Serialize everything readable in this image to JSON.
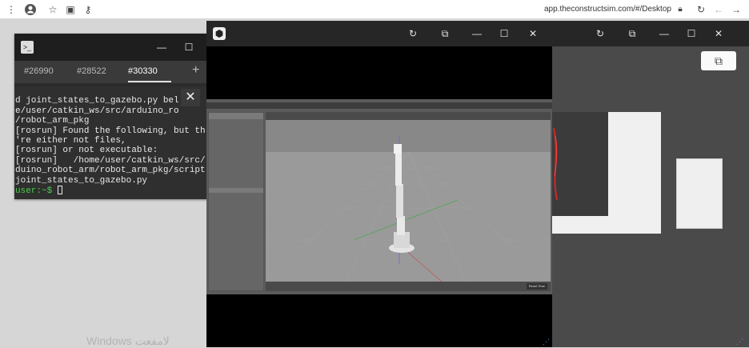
{
  "browser": {
    "url": "app.theconstructsim.com/#/Desktop",
    "icons": [
      "kebab-menu-icon",
      "account-icon",
      "star-icon",
      "screen-cast-icon",
      "key-icon",
      "lock-icon",
      "reload-icon",
      "back-icon",
      "forward-icon"
    ]
  },
  "terminal": {
    "tabs": [
      "#26990",
      "#28522",
      "#30330"
    ],
    "active_tab": "#30330",
    "lines": [
      "d joint_states_to_gazebo.py bel",
      "e/user/catkin_ws/src/arduino_ro",
      "/robot_arm_pkg",
      "[rosrun] Found the following, but th",
      "'re either not files,",
      "[rosrun] or not executable:",
      "[rosrun]   /home/user/catkin_ws/src/",
      "duino_robot_arm/robot_arm_pkg/script",
      "joint_states_to_gazebo.py"
    ],
    "prompt": "user:~$"
  },
  "gazebo": {
    "bottom_button": "Reset Time"
  },
  "watermark": "Windows لامفعت"
}
